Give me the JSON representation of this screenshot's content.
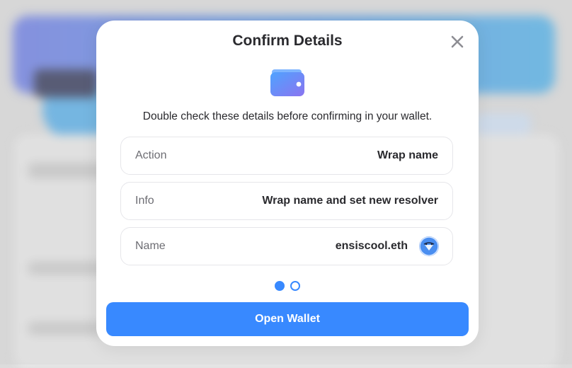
{
  "modal": {
    "title": "Confirm Details",
    "subtitle": "Double check these details before confirming in your wallet.",
    "rows": [
      {
        "label": "Action",
        "value": "Wrap name"
      },
      {
        "label": "Info",
        "value": "Wrap name and set new resolver"
      },
      {
        "label": "Name",
        "value": "ensiscool.eth"
      }
    ],
    "step": {
      "current": 1,
      "total": 2
    },
    "primary_button": "Open Wallet"
  },
  "colors": {
    "accent": "#3889ff",
    "wallet_gradient_start": "#4fa3ff",
    "wallet_gradient_end": "#8a74f0"
  },
  "icons": [
    "close-icon",
    "wallet-icon",
    "avatar"
  ]
}
